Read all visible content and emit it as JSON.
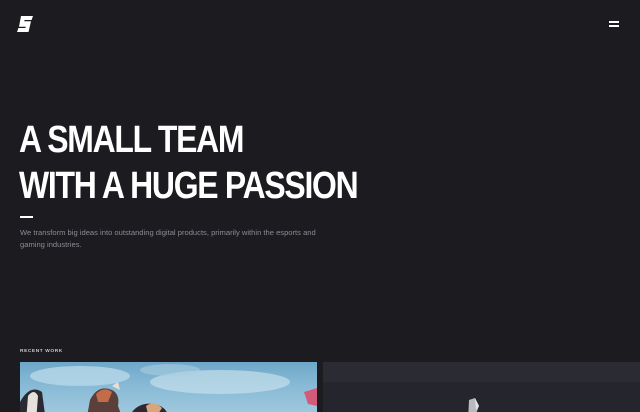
{
  "header": {
    "logo_icon": "stylized-s-logo-icon",
    "menu_icon": "hamburger-menu-icon"
  },
  "hero": {
    "headline_line1": "A SMALL TEAM",
    "headline_line2": "WITH A HUGE PASSION",
    "tagline": "We transform big ideas into outstanding digital products, primarily within the esports and gaming industries."
  },
  "recent_work": {
    "label": "RECENT WORK"
  },
  "colors": {
    "background": "#1b1b20",
    "text_primary": "#ffffff",
    "text_secondary": "#8b8c93",
    "card_dark": "#26272e",
    "card_sky": "#88bad6"
  }
}
